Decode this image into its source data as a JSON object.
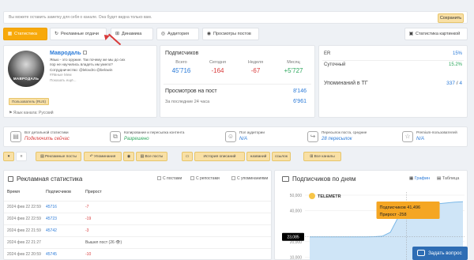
{
  "note": {
    "text": "Вы можете оставить заметку для себя о канале. Она будет видна только вам.",
    "save": "Сохранить"
  },
  "tabs": [
    {
      "label": "Статистика",
      "icon": "stats-icon"
    },
    {
      "label": "Рекламные отдачи",
      "icon": "refresh-icon"
    },
    {
      "label": "Динамика",
      "icon": "chart-icon"
    },
    {
      "label": "Аудитория",
      "icon": "audience-icon"
    },
    {
      "label": "Просмотры постов",
      "icon": "eye-icon"
    }
  ],
  "tab_right": "Статистика картинкой",
  "profile": {
    "name": "Мавродаль",
    "avatar_caption": "МАВРОДАЛЬ",
    "desc_lines": [
      "Явью - это оружие. Так почему же мы до сих",
      "пор не научились владеть им умело?",
      "Сотрудничество: @lelovdro @belowin"
    ],
    "more1": "#Явные Мем",
    "more2": "Показать ещё...",
    "badge": "Пользователь (RUS)",
    "lang": "Язык канала: Русский"
  },
  "subs": {
    "title": "Подписчиков",
    "cols": [
      {
        "label": "Всего",
        "value": "45'716"
      },
      {
        "label": "Сегодня",
        "value": "-164"
      },
      {
        "label": "Неделя",
        "value": "-67"
      },
      {
        "label": "Месяц",
        "value": "+5'727"
      }
    ],
    "views_label": "Просмотров на пост",
    "views_value": "8'146",
    "last24_label": "За последние 24 часа",
    "last24_value": "6'961"
  },
  "er": {
    "er_label": "ER",
    "er_value": "15%",
    "daily_label": "Суточный",
    "daily_value": "15.2%",
    "mentions_label": "Упоминаний в ТГ",
    "mentions_value": "337",
    "mentions_extra": "4"
  },
  "stats": [
    {
      "title": "Вот детальной статистики",
      "value": "Подключить сейчас",
      "icon": "chart-icon"
    },
    {
      "title": "Копирование и пересылка контента",
      "value": "Разрешено",
      "icon": "copy-icon"
    },
    {
      "title": "Пол аудитории",
      "value": "N/A",
      "icon": "user-icon"
    },
    {
      "title": "Пересылок поста, средние",
      "value": "28 пересылок",
      "icon": "forward-icon"
    },
    {
      "title": "Premium-пользователей",
      "value": "N/A",
      "icon": "star-icon"
    }
  ],
  "tools": {
    "posts_ads": "Рекламные посты",
    "mentions": "Упоминания",
    "all_posts": "Все посты",
    "history": "История описаний",
    "names": "названий",
    "links": "ссылок",
    "all_channels": "Все каналы"
  },
  "adv": {
    "title": "Рекламная статистика",
    "chk1": "С постами",
    "chk2": "С репостами",
    "chk3": "С упоминаниями",
    "headers": [
      "Время",
      "Подписчиков",
      "Прирост"
    ],
    "rows": [
      {
        "date": "2024 фев 22 22:59",
        "subs": "45716",
        "growth": "-7"
      },
      {
        "date": "2024 фев 22 22:59",
        "subs": "45723",
        "growth": "-19"
      },
      {
        "date": "2024 фев 22 21:59",
        "subs": "45742",
        "growth": "-3"
      },
      {
        "date": "2024 фев 22 21:27",
        "subs": "",
        "growth": "Вышел пост (26 👁)"
      },
      {
        "date": "2024 фев 22 20:59",
        "subs": "45745",
        "growth": "-10"
      }
    ]
  },
  "chart": {
    "title": "Подписчиков по дням",
    "tab1": "Графин",
    "tab2": "Таблица",
    "brand": "TELEMETR",
    "tooltip_subs_label": "Подписчиков",
    "tooltip_subs_value": "41,496",
    "tooltip_growth_label": "Прирост",
    "tooltip_growth_value": "-258",
    "cursor_value": "23,085"
  },
  "chart_data": {
    "type": "area",
    "yticks": [
      "50,000",
      "40,000",
      "20,000",
      "10,000"
    ],
    "ylim": [
      0,
      52000
    ],
    "values": [
      23085,
      23085,
      23085,
      23085,
      23085,
      23085,
      23085,
      23085,
      23200,
      23500,
      26000,
      36000,
      41496,
      42000,
      43000,
      44000,
      44500,
      45000,
      45500,
      45716
    ]
  },
  "chat": "Задать вопрос"
}
